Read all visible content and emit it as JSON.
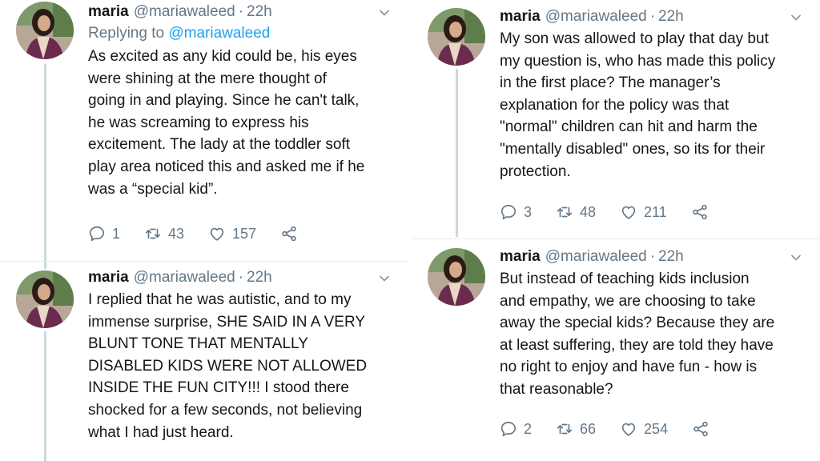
{
  "tweets": {
    "t1": {
      "name": "maria",
      "handle": "@mariawaleed",
      "dot": "·",
      "time": "22h",
      "reply_prefix": "Replying to",
      "reply_to": "@mariawaleed",
      "lines": [
        "As excited as any kid could be, his eyes",
        "were shining at the mere thought of",
        "going in and playing. Since he can't talk,",
        "he was screaming to express his",
        "excitement. The lady at the toddler soft",
        "play area noticed this and asked me if he",
        "was a “special kid”."
      ],
      "replies": "1",
      "retweets": "43",
      "likes": "157"
    },
    "t2": {
      "name": "maria",
      "handle": "@mariawaleed",
      "dot": "·",
      "time": "22h",
      "lines": [
        "I replied that he was autistic, and to my",
        "immense surprise, SHE SAID IN A VERY",
        "BLUNT TONE THAT MENTALLY",
        "DISABLED KIDS WERE NOT ALLOWED",
        "INSIDE THE FUN CITY!!! I stood there",
        "shocked for a few seconds, not believing",
        "what I had just heard."
      ]
    },
    "t3": {
      "name": "maria",
      "handle": "@mariawaleed",
      "dot": "·",
      "time": "22h",
      "lines": [
        "My son was allowed to play that day but",
        "my question is, who has made this policy",
        "in the first place? The manager’s",
        "explanation for the policy was that",
        "\"normal\" children can hit and harm the",
        "\"mentally disabled\" ones, so its for their",
        "protection."
      ],
      "replies": "3",
      "retweets": "48",
      "likes": "211"
    },
    "t4": {
      "name": "maria",
      "handle": "@mariawaleed",
      "dot": "·",
      "time": "22h",
      "lines": [
        "But instead of teaching kids inclusion",
        "and empathy, we are choosing to take",
        "away the special kids? Because they are",
        "at least suffering, they are told they have",
        "no right to enjoy and have fun - how is",
        "that reasonable?"
      ],
      "replies": "2",
      "retweets": "66",
      "likes": "254"
    }
  },
  "icons": {
    "reply": "reply-icon",
    "retweet": "retweet-icon",
    "like": "heart-icon",
    "share": "share-icon",
    "caret": "chevron-down-icon"
  },
  "colors": {
    "text": "#14171a",
    "muted": "#657786",
    "link": "#1da1f2",
    "thread": "#ccd6dd"
  }
}
